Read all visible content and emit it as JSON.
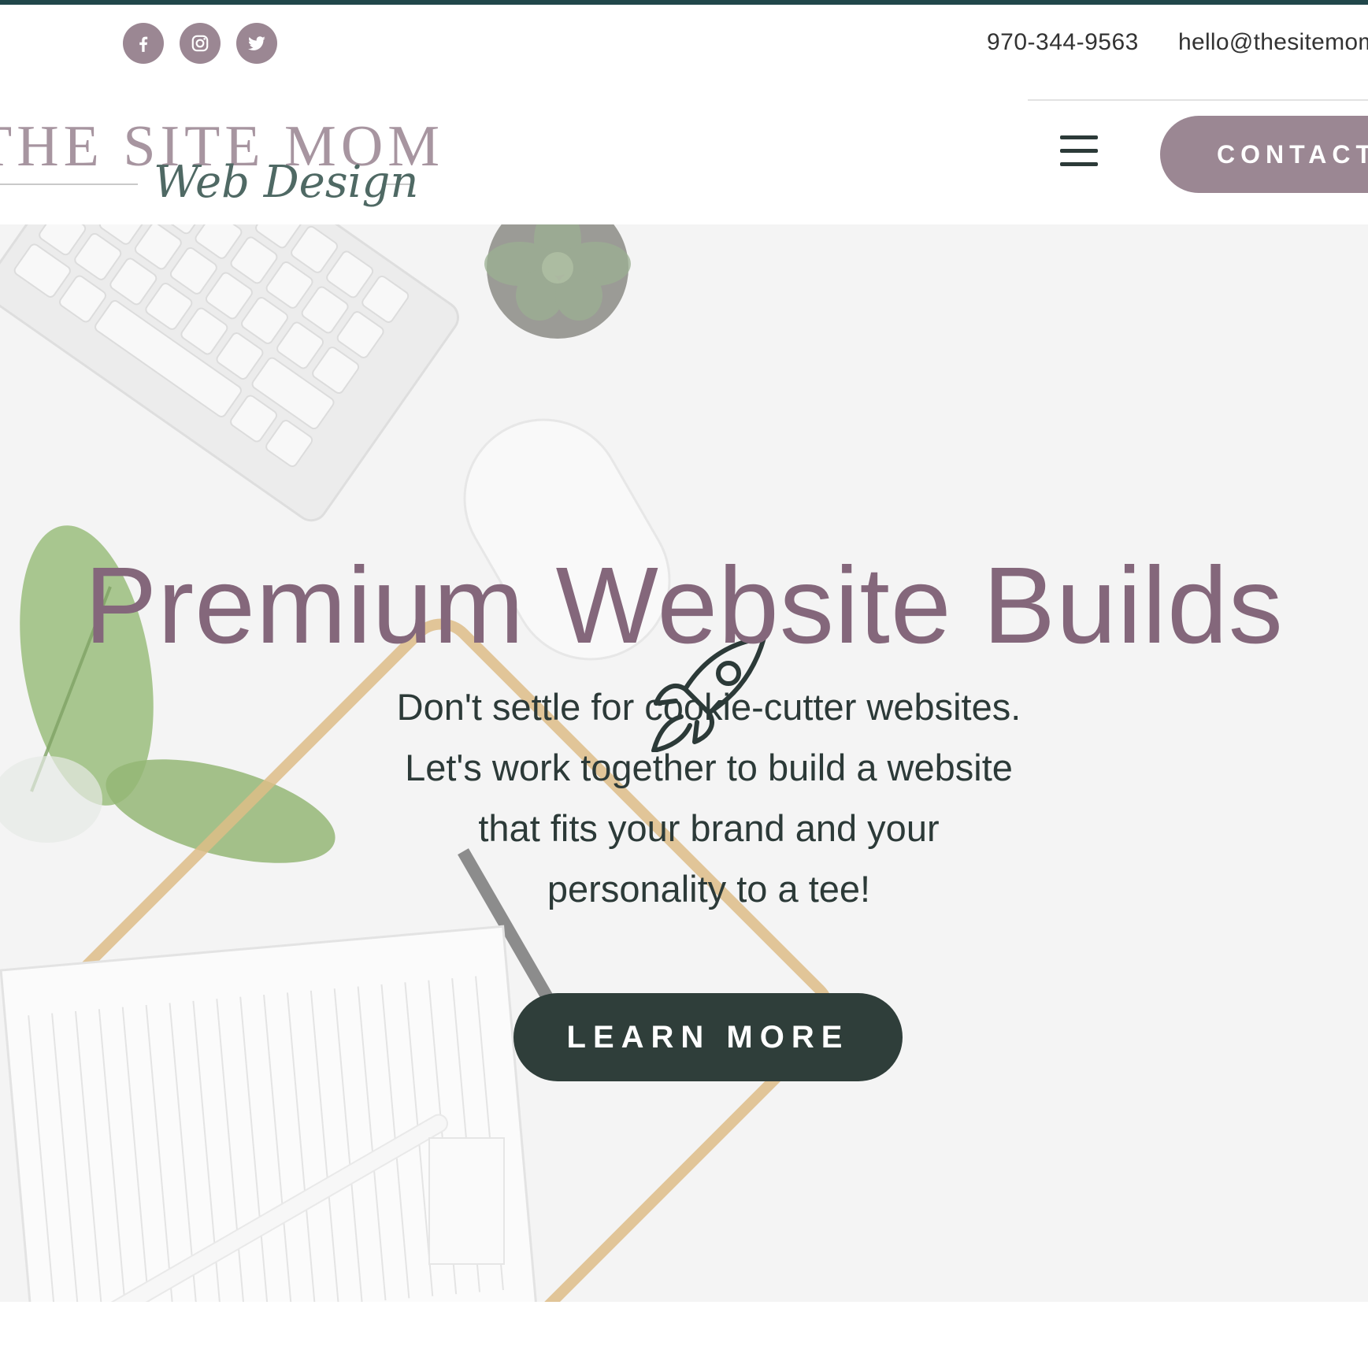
{
  "topbar": {
    "social": [
      {
        "name": "facebook-icon"
      },
      {
        "name": "instagram-icon"
      },
      {
        "name": "twitter-icon"
      }
    ],
    "phone": "970-344-9563",
    "email": "hello@thesitemom"
  },
  "logo": {
    "title": "THE SITE MOM",
    "script": "Web Design"
  },
  "header": {
    "menu_icon": "hamburger-icon",
    "contact_label": "CONTACT"
  },
  "hero": {
    "icon": "rocket-icon",
    "headline": "Premium Website Builds",
    "lines": [
      "Don't settle for cookie-cutter websites.",
      "Let's work together to build a website",
      "that fits your brand and your",
      "personality to a tee!"
    ],
    "cta_label": "LEARN MORE"
  },
  "colors": {
    "accent_mauve": "#9b8793",
    "headline_mauve": "#84677b",
    "dark_green": "#2f3e3a",
    "top_border": "#21474a"
  }
}
